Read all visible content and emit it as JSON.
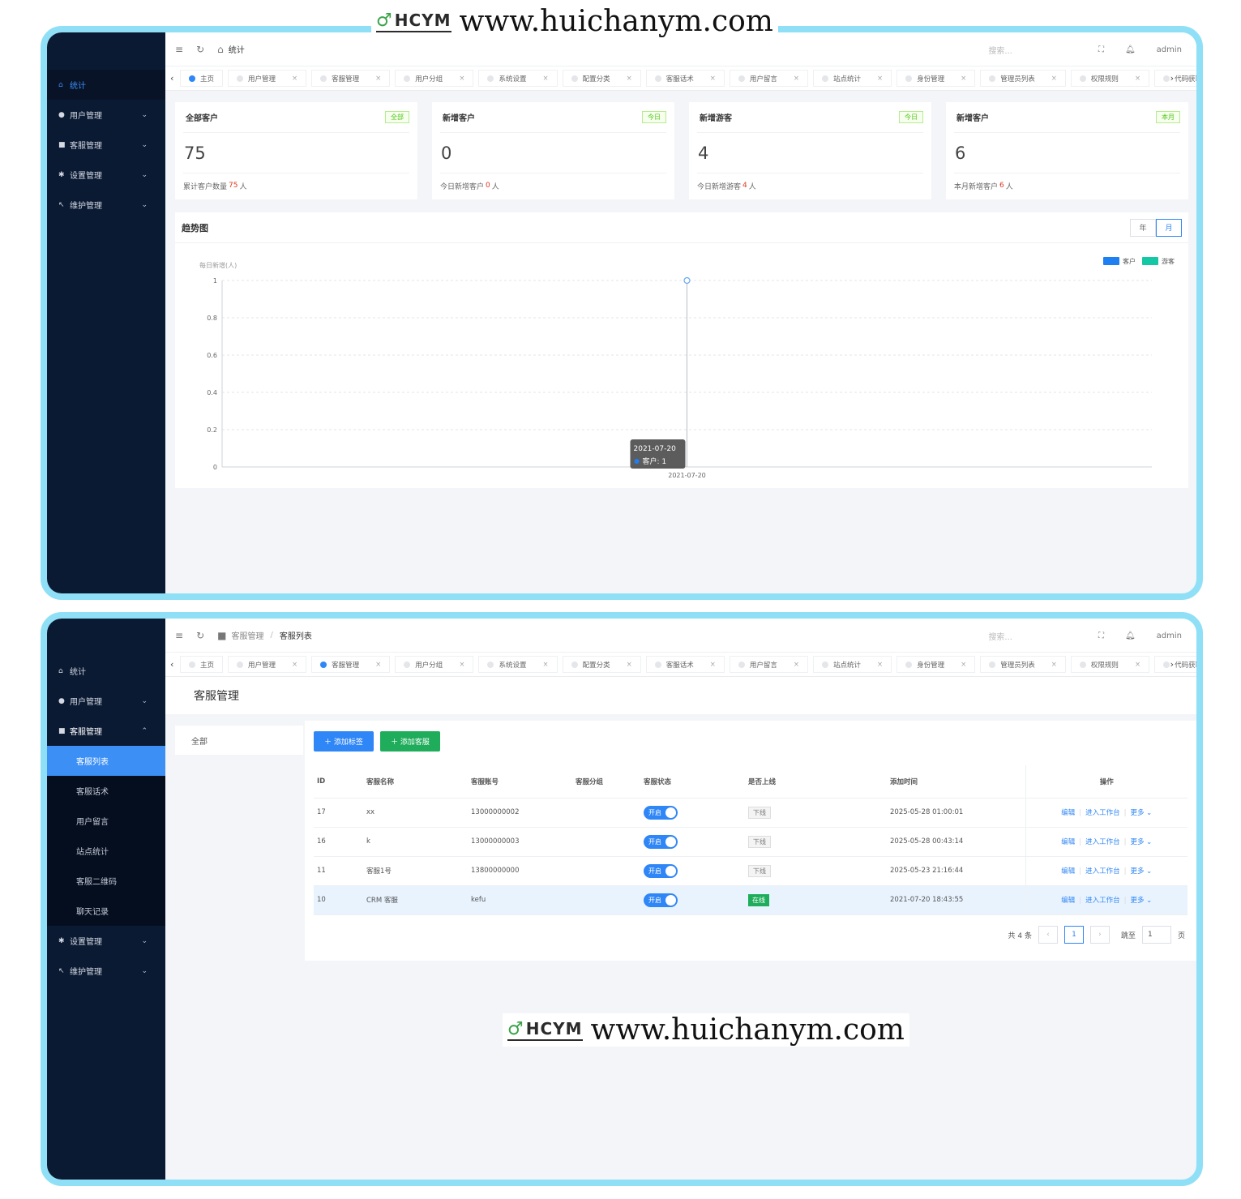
{
  "watermark": {
    "logo": "HCYM",
    "url": "www.huichanym.com"
  },
  "screen1": {
    "topbar": {
      "breadcrumb": "统计",
      "search_placeholder": "搜索...",
      "user": "admin"
    },
    "sidebar": [
      {
        "label": "统计",
        "active": true
      },
      {
        "label": "用户管理"
      },
      {
        "label": "客服管理"
      },
      {
        "label": "设置管理"
      },
      {
        "label": "维护管理"
      }
    ],
    "tabs": [
      {
        "label": "主页",
        "active": true
      },
      {
        "label": "用户管理"
      },
      {
        "label": "客服管理"
      },
      {
        "label": "用户分组"
      },
      {
        "label": "系统设置"
      },
      {
        "label": "配置分类"
      },
      {
        "label": "客服话术"
      },
      {
        "label": "用户留言"
      },
      {
        "label": "站点统计"
      },
      {
        "label": "身份管理"
      },
      {
        "label": "管理员列表"
      },
      {
        "label": "权限规则"
      },
      {
        "label": "代码获取"
      }
    ],
    "cards": [
      {
        "title": "全部客户",
        "badge": "全部",
        "value": "75",
        "foot_prefix": "累计客户数量",
        "foot_num": "75",
        "foot_suffix": "人"
      },
      {
        "title": "新增客户",
        "badge": "今日",
        "value": "0",
        "foot_prefix": "今日新增客户",
        "foot_num": "0",
        "foot_suffix": "人"
      },
      {
        "title": "新增游客",
        "badge": "今日",
        "value": "4",
        "foot_prefix": "今日新增游客",
        "foot_num": "4",
        "foot_suffix": "人"
      },
      {
        "title": "新增客户",
        "badge": "本月",
        "value": "6",
        "foot_prefix": "本月新增客户",
        "foot_num": "6",
        "foot_suffix": "人"
      }
    ],
    "chart_panel": {
      "title": "趋势图",
      "seg_year": "年",
      "seg_month": "月",
      "seg_selected": "月"
    }
  },
  "chart_data": {
    "type": "line",
    "title": "",
    "ylabel": "每日新增(人)",
    "xlabel": "",
    "x": [
      "2021-07-20"
    ],
    "ylim": [
      0,
      1
    ],
    "yticks": [
      0,
      0.2,
      0.4,
      0.6,
      0.8,
      1
    ],
    "series": [
      {
        "name": "客户",
        "values": [
          1
        ],
        "color": "#1e7ff2"
      },
      {
        "name": "游客",
        "values": [
          0
        ],
        "color": "#14c8a5"
      }
    ],
    "legend": "top-right",
    "grid": true,
    "tooltip": {
      "title": "2021-07-20",
      "line": "客户: 1"
    }
  },
  "screen2": {
    "topbar": {
      "crumb1": "客服管理",
      "crumb2": "客服列表",
      "search_placeholder": "搜索...",
      "user": "admin"
    },
    "sidebar": {
      "stats": "统计",
      "user_mgmt": "用户管理",
      "cs_mgmt": "客服管理",
      "sub": [
        "客服列表",
        "客服话术",
        "用户留言",
        "站点统计",
        "客服二维码",
        "聊天记录"
      ],
      "settings": "设置管理",
      "maintain": "维护管理"
    },
    "tabs": [
      {
        "label": "主页"
      },
      {
        "label": "用户管理"
      },
      {
        "label": "客服管理",
        "active": true
      },
      {
        "label": "用户分组"
      },
      {
        "label": "系统设置"
      },
      {
        "label": "配置分类"
      },
      {
        "label": "客服话术"
      },
      {
        "label": "用户留言"
      },
      {
        "label": "站点统计"
      },
      {
        "label": "身份管理"
      },
      {
        "label": "管理员列表"
      },
      {
        "label": "权限规则"
      },
      {
        "label": "代码获取"
      }
    ],
    "page_title": "客服管理",
    "category": "全部",
    "buttons": {
      "add_tag": "＋ 添加标签",
      "add_cs": "＋ 添加客服"
    },
    "columns": [
      "ID",
      "客服名称",
      "客服账号",
      "客服分组",
      "客服状态",
      "是否上线",
      "添加时间",
      "操作"
    ],
    "rows": [
      {
        "id": "17",
        "name": "xx",
        "account": "13000000002",
        "group": "",
        "status": "开启",
        "online": "下线",
        "time": "2025-05-28 01:00:01"
      },
      {
        "id": "16",
        "name": "k",
        "account": "13000000003",
        "group": "",
        "status": "开启",
        "online": "下线",
        "time": "2025-05-28 00:43:14"
      },
      {
        "id": "11",
        "name": "客服1号",
        "account": "13800000000",
        "group": "",
        "status": "开启",
        "online": "下线",
        "time": "2025-05-23 21:16:44"
      },
      {
        "id": "10",
        "name": "CRM 客服",
        "account": "kefu",
        "group": "",
        "status": "开启",
        "online": "在线",
        "time": "2021-07-20 18:43:55"
      }
    ],
    "row_actions": {
      "edit": "编辑",
      "workbench": "进入工作台",
      "more": "更多 ⌄"
    },
    "pager": {
      "total": "共 4 条",
      "prev": "‹",
      "page": "1",
      "next": "›",
      "goto": "跳至",
      "goto_value": "1",
      "page_unit": "页"
    }
  }
}
